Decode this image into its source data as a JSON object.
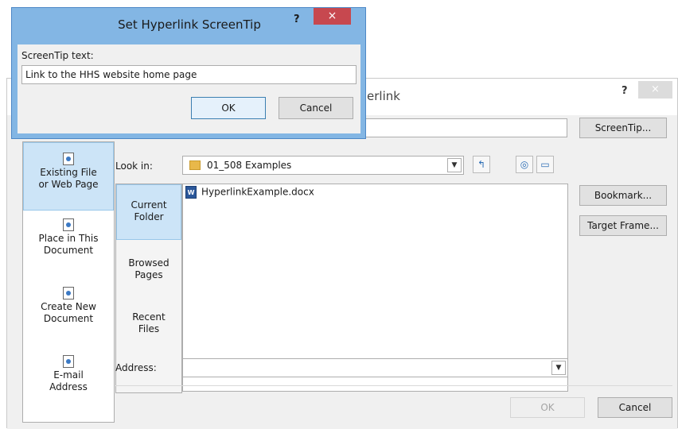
{
  "screentip_dialog": {
    "title": "Set Hyperlink ScreenTip",
    "help": "?",
    "close": "×",
    "label": "ScreenTip text:",
    "input_value": "Link to the HHS website home page",
    "ok_label": "OK",
    "cancel_label": "Cancel"
  },
  "insert_hyperlink_dialog": {
    "title_visible": "erlink",
    "help": "?",
    "close": "×",
    "screentip_button": "ScreenTip...",
    "link_to": [
      {
        "label_line1": "Existing File",
        "label_line2": "or Web Page"
      },
      {
        "label_line1": "Place in This",
        "label_line2": "Document"
      },
      {
        "label_line1": "Create New",
        "label_line2": "Document"
      },
      {
        "label_line1": "E-mail",
        "label_line2": "Address"
      }
    ],
    "look_in_label": "Look in:",
    "look_in_value": "01_508 Examples",
    "browse_tabs": [
      {
        "line1": "Current",
        "line2": "Folder"
      },
      {
        "line1": "Browsed",
        "line2": "Pages"
      },
      {
        "line1": "Recent",
        "line2": "Files"
      }
    ],
    "files": [
      "HyperlinkExample.docx"
    ],
    "bookmark_button": "Bookmark...",
    "target_frame_button": "Target Frame...",
    "address_label": "Address:",
    "address_value": "",
    "ok_label": "OK",
    "cancel_label": "Cancel"
  },
  "colors": {
    "screentip_frame": "#83b6e4",
    "close_button_active": "#c7484f",
    "selection": "#cce4f7"
  }
}
